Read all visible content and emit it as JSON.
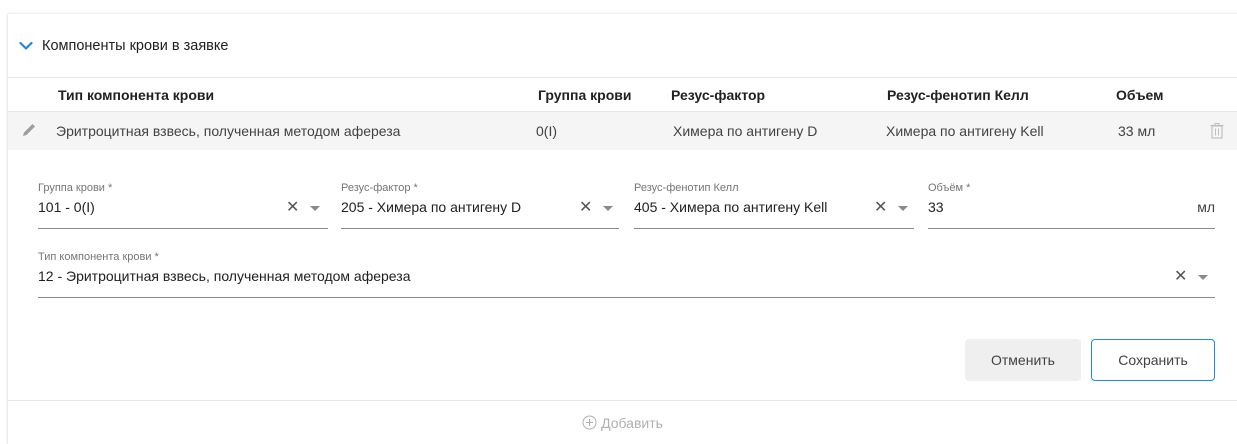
{
  "section": {
    "title": "Компоненты крови в заявке"
  },
  "table": {
    "headers": [
      "Тип компонента крови",
      "Группа крови",
      "Резус-фактор",
      "Резус-фенотип Келл",
      "Объем"
    ],
    "rows": [
      [
        "Эритроцитная взвесь, полученная методом афереза",
        "0(I)",
        "Химера по антигену D",
        "Химера по антигену Kell",
        "33 мл"
      ]
    ]
  },
  "form": {
    "blood_group": {
      "label": "Группа крови *",
      "value": "101 - 0(I)"
    },
    "rh_factor": {
      "label": "Резус-фактор *",
      "value": "205 - Химера по антигену D"
    },
    "kell": {
      "label": "Резус-фенотип Келл",
      "value": "405 - Химера по антигену Kell"
    },
    "volume": {
      "label": "Объём *",
      "value": "33",
      "unit": "мл"
    },
    "component_type": {
      "label": "Тип компонента крови *",
      "value": "12 - Эритроцитная взвесь, полученная методом афереза"
    },
    "clear_symbol": "✕"
  },
  "buttons": {
    "cancel": "Отменить",
    "save": "Сохранить"
  },
  "add": {
    "label": "Добавить"
  },
  "colors": {
    "accent": "#1e88e5",
    "row_bg": "#f5f5f5",
    "muted": "#b0b0b0"
  }
}
